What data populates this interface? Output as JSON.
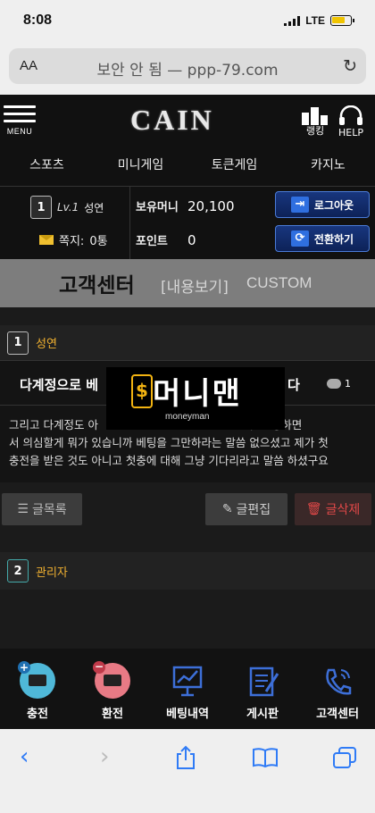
{
  "status_bar": {
    "time": "8:08",
    "network": "LTE"
  },
  "browser": {
    "aa": "AA",
    "url": "보안 안 됨 — ppp-79.com"
  },
  "header": {
    "menu_label": "MENU",
    "logo": "CAIN",
    "ranking_label": "랭킹",
    "help_label": "HELP"
  },
  "game_nav": [
    "스포츠",
    "미니게임",
    "토큰게임",
    "카지노"
  ],
  "user": {
    "level": "1",
    "level_text": "Lv.1",
    "name": "성연",
    "message_label": "쪽지:",
    "message_count": "0통",
    "money_label": "보유머니",
    "money_value": "20,100",
    "point_label": "포인트",
    "point_value": "0",
    "logout_label": "로그아웃",
    "switch_label": "전환하기"
  },
  "section": {
    "title": "고객센터",
    "subtitle": "[내용보기]",
    "english": "CUSTOM"
  },
  "post": {
    "author_level": "1",
    "author": "성연",
    "title_start": "다계정으로 베",
    "title_end": "다",
    "comment_count": "1",
    "body_line1": "그리고 다계정도 아                                         다 ㅂ 팅하면",
    "body_line2": "서 의심할게 뭐가 있습니까 베팅을 그만하라는 말씀 없으셨고 제가 첫",
    "body_line3": "충전을 받은 것도 아니고 첫충에 대해 그냥 기다리라고 말씀 하셨구요"
  },
  "watermark": {
    "title": "머니맨",
    "coin": "$",
    "sub": "moneyman"
  },
  "buttons": {
    "list": "글목록",
    "edit": "글편집",
    "delete": "글삭제"
  },
  "reply": {
    "level": "2",
    "author": "관리자"
  },
  "bottom_nav": [
    {
      "label": "충전",
      "icon": "charge-icon"
    },
    {
      "label": "환전",
      "icon": "exchange-icon"
    },
    {
      "label": "베팅내역",
      "icon": "chart-icon"
    },
    {
      "label": "게시판",
      "icon": "board-icon"
    },
    {
      "label": "고객센터",
      "icon": "phone-icon"
    }
  ],
  "colors": {
    "accent_blue": "#2f6fe0",
    "author_gold": "#f0b030",
    "delete_red": "#e04848"
  }
}
